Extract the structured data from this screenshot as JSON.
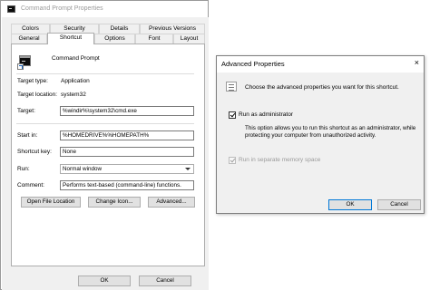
{
  "main_window": {
    "title": "Command Prompt Properties",
    "tabs_row1": [
      "Colors",
      "Security",
      "Details",
      "Previous Versions"
    ],
    "tabs_row2": [
      "General",
      "Shortcut",
      "Options",
      "Font",
      "Layout"
    ],
    "active_tab": "Shortcut",
    "shortcut_name": "Command Prompt",
    "target_type_label": "Target type:",
    "target_type_value": "Application",
    "target_location_label": "Target location:",
    "target_location_value": "system32",
    "target_label": "Target:",
    "target_value": "%windir%\\system32\\cmd.exe",
    "start_in_label": "Start in:",
    "start_in_value": "%HOMEDRIVE%%HOMEPATH%",
    "shortcut_key_label": "Shortcut key:",
    "shortcut_key_value": "None",
    "run_label": "Run:",
    "run_value": "Normal window",
    "comment_label": "Comment:",
    "comment_value": "Performs text-based (command-line) functions.",
    "buttons": {
      "open_file_location": "Open File Location",
      "change_icon": "Change Icon...",
      "advanced": "Advanced..."
    },
    "footer": {
      "ok": "OK",
      "cancel": "Cancel"
    }
  },
  "advanced_dialog": {
    "title": "Advanced Properties",
    "close_glyph": "×",
    "instruction": "Choose the advanced properties you want for this shortcut.",
    "run_as_admin_label": "Run as administrator",
    "run_as_admin_checked": true,
    "description": "This option allows you to run this shortcut as an administrator, while protecting your computer from unauthorized activity.",
    "separate_memory_label": "Run in separate memory space",
    "separate_memory_checked": true,
    "separate_memory_enabled": false,
    "ok": "OK",
    "cancel": "Cancel"
  }
}
